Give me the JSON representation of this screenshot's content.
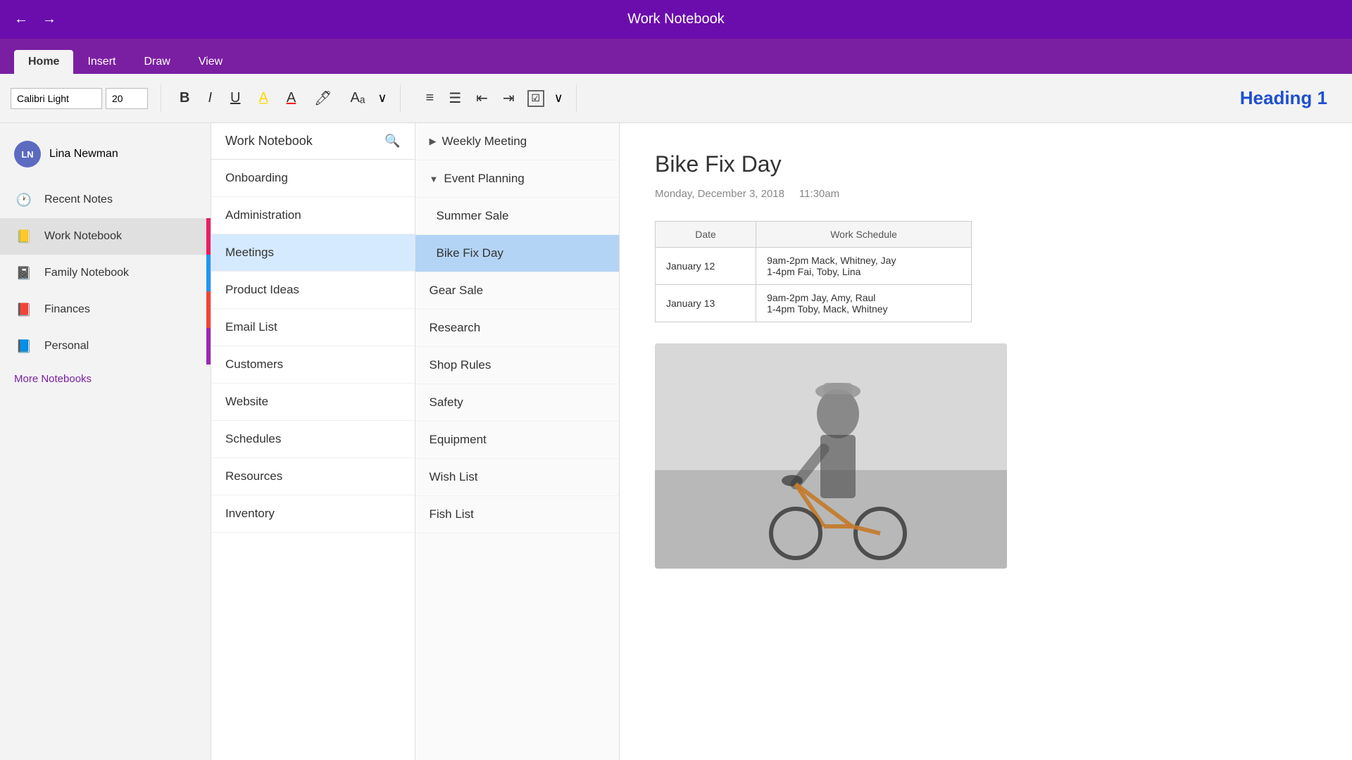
{
  "titleBar": {
    "title": "Work Notebook",
    "backArrow": "←",
    "forwardArrow": "→"
  },
  "tabs": [
    {
      "label": "Home",
      "active": true
    },
    {
      "label": "Insert",
      "active": false
    },
    {
      "label": "Draw",
      "active": false
    },
    {
      "label": "View",
      "active": false
    }
  ],
  "ribbon": {
    "fontName": "Calibri Light",
    "fontSize": "20",
    "boldLabel": "B",
    "italicLabel": "I",
    "underlineLabel": "U",
    "heading1Label": "Heading 1",
    "moreDropdown": "∨"
  },
  "sidebar": {
    "user": {
      "initials": "LN",
      "name": "Lina Newman"
    },
    "items": [
      {
        "label": "Recent Notes",
        "icon": "🕐"
      },
      {
        "label": "Work Notebook",
        "icon": "📖",
        "active": true
      },
      {
        "label": "Family Notebook",
        "icon": "📓"
      },
      {
        "label": "Finances",
        "icon": "📕"
      },
      {
        "label": "Personal",
        "icon": "📘"
      }
    ],
    "moreLabel": "More Notebooks"
  },
  "sectionsPanel": {
    "notebookName": "Work Notebook",
    "sections": [
      {
        "label": "Onboarding",
        "active": false
      },
      {
        "label": "Administration",
        "active": false
      },
      {
        "label": "Meetings",
        "active": true
      },
      {
        "label": "Product Ideas",
        "active": false
      },
      {
        "label": "Email List",
        "active": false
      },
      {
        "label": "Customers",
        "active": false
      },
      {
        "label": "Website",
        "active": false
      },
      {
        "label": "Schedules",
        "active": false
      },
      {
        "label": "Resources",
        "active": false
      },
      {
        "label": "Inventory",
        "active": false
      }
    ]
  },
  "pagesPanel": {
    "pages": [
      {
        "label": "Weekly Meeting",
        "indent": false,
        "collapsed": true
      },
      {
        "label": "Event Planning",
        "indent": false,
        "expanded": true
      },
      {
        "label": "Summer Sale",
        "indent": true
      },
      {
        "label": "Bike Fix Day",
        "indent": true,
        "active": true
      },
      {
        "label": "Gear Sale",
        "indent": false
      },
      {
        "label": "Research",
        "indent": false
      },
      {
        "label": "Shop Rules",
        "indent": false
      },
      {
        "label": "Safety",
        "indent": false
      },
      {
        "label": "Equipment",
        "indent": false
      },
      {
        "label": "Wish List",
        "indent": false
      },
      {
        "label": "Fish List",
        "indent": false
      }
    ]
  },
  "content": {
    "title": "Bike Fix Day",
    "date": "Monday, December 3, 2018",
    "time": "11:30am",
    "table": {
      "headers": [
        "Date",
        "Work Schedule"
      ],
      "rows": [
        {
          "date": "January 12",
          "schedule": "9am-2pm Mack, Whitney, Jay\n1-4pm Fai, Toby, Lina"
        },
        {
          "date": "January 13",
          "schedule": "9am-2pm Jay, Amy, Raul\n1-4pm Toby, Mack, Whitney"
        }
      ]
    }
  },
  "sectionColors": [
    "#e91e63",
    "#9c27b0",
    "#00bcd4",
    "#8bc34a",
    "#4caf50",
    "#cddc39",
    "#ff9800",
    "#ff5722",
    "#f44336",
    "#e91e8c"
  ]
}
